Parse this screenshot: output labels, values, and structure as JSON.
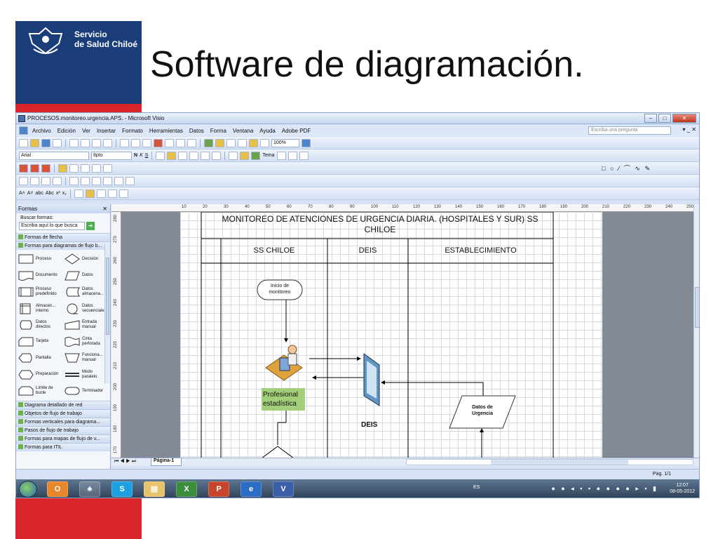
{
  "slide": {
    "brand_line1": "Servicio",
    "brand_line2": "de Salud Chiloé",
    "title": "Software de diagramación."
  },
  "window": {
    "title": "PROCESOS.monitoreo.urgencia.APS. - Microsoft Visio",
    "menu": [
      "Archivo",
      "Edición",
      "Ver",
      "Insertar",
      "Formato",
      "Herramientas",
      "Datos",
      "Forma",
      "Ventana",
      "Ayuda",
      "Adobe PDF"
    ],
    "ask_placeholder": "Escriba una pregunta",
    "font_name": "Arial",
    "font_size": "8pto",
    "zoom": "100%",
    "theme_label": "Tema"
  },
  "shapes_panel": {
    "title": "Formas",
    "search_label": "Buscar formas:",
    "search_placeholder": "Escriba aquí lo que busca",
    "stencils_top": [
      "Formas de flecha",
      "Formas para diagramas de flujo b..."
    ],
    "shapes": [
      {
        "label": "Proceso",
        "icon": "process-shape-icon"
      },
      {
        "label": "Decisión",
        "icon": "decision-shape-icon"
      },
      {
        "label": "Documento",
        "icon": "document-shape-icon"
      },
      {
        "label": "Datos",
        "icon": "data-shape-icon"
      },
      {
        "label": "Proceso predefinido",
        "icon": "predefined-process-icon"
      },
      {
        "label": "Datos almacena...",
        "icon": "stored-data-icon"
      },
      {
        "label": "Almacen... interno",
        "icon": "internal-storage-icon"
      },
      {
        "label": "Datos secuenciales",
        "icon": "sequential-data-icon"
      },
      {
        "label": "Datos directos",
        "icon": "direct-data-icon"
      },
      {
        "label": "Entrada manual",
        "icon": "manual-input-icon"
      },
      {
        "label": "Tarjeta",
        "icon": "card-shape-icon"
      },
      {
        "label": "Cinta perforada",
        "icon": "punched-tape-icon"
      },
      {
        "label": "Pantalla",
        "icon": "display-shape-icon"
      },
      {
        "label": "Funciona... manual",
        "icon": "manual-operation-icon"
      },
      {
        "label": "Preparación",
        "icon": "preparation-shape-icon"
      },
      {
        "label": "Modo paralelo",
        "icon": "parallel-mode-icon"
      },
      {
        "label": "Límite de bucle",
        "icon": "loop-limit-icon"
      },
      {
        "label": "Terminador",
        "icon": "terminator-shape-icon"
      }
    ],
    "stencils_bottom": [
      "Diagrama detallado de red",
      "Objetos de flujo de trabajo",
      "Formas verticales para diagrama...",
      "Pasos de flujo de trabajo",
      "Formas para mapas de flujo de v...",
      "Formas para ITIL"
    ]
  },
  "ruler": {
    "h": [
      "10",
      "20",
      "30",
      "40",
      "50",
      "60",
      "70",
      "80",
      "90",
      "100",
      "110",
      "120",
      "130",
      "140",
      "150",
      "160",
      "170",
      "180",
      "190",
      "200",
      "210",
      "220",
      "230",
      "240",
      "250"
    ],
    "v": [
      "280",
      "270",
      "260",
      "250",
      "240",
      "230",
      "220",
      "210",
      "200",
      "190",
      "180",
      "170"
    ]
  },
  "diagram": {
    "title": "MONITOREO DE ATENCIONES DE URGENCIA DIARIA. (HOSPITALES Y SUR) SS CHILOE",
    "lanes": [
      "SS CHILOE",
      "DEIS",
      "ESTABLECIMIENTO"
    ],
    "start_label": "Inicio de monitoreo",
    "actor_label": "Profesional estadística",
    "deis_label": "DEIS",
    "data_label": "Datos de Urgencia"
  },
  "page_tab": "Página-1",
  "status_page": "Pág. 1/1",
  "taskbar": {
    "lang": "ES",
    "time": "12:07",
    "date": "08-05-2012"
  }
}
